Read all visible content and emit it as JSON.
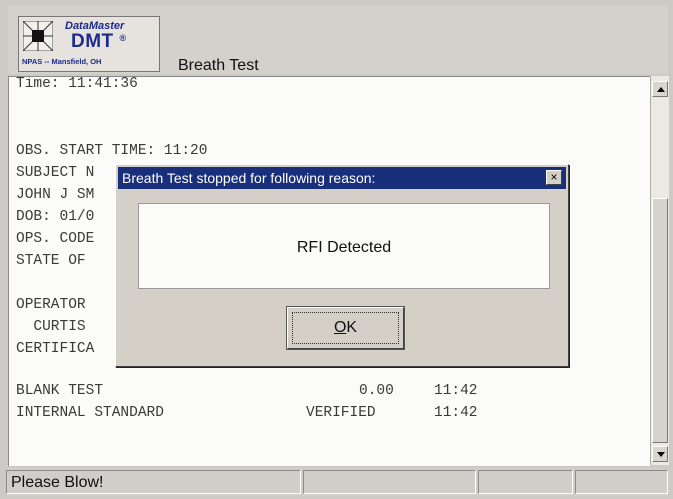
{
  "header": {
    "logo": {
      "brand": "DataMaster",
      "model": "DMT",
      "reg_mark": "®",
      "location": "NPAS -- Mansfield, OH"
    },
    "title": "Breath Test"
  },
  "report": {
    "lines": [
      "Time: 11:41:36",
      "OBS. START TIME: 11:20",
      "SUBJECT N",
      "JOHN J SM",
      "DOB: 01/0",
      "OPS. CODE",
      "STATE OF",
      "OPERATOR",
      "  CURTIS",
      "CERTIFICA"
    ],
    "results": [
      {
        "label": "BLANK TEST",
        "value": "0.00",
        "time": "11:42"
      },
      {
        "label": "INTERNAL STANDARD",
        "value": "VERIFIED",
        "time": "11:42"
      }
    ]
  },
  "dialog": {
    "title": "Breath Test stopped for following reason:",
    "close_glyph": "×",
    "message": "RFI Detected",
    "ok_label_underlined": "O",
    "ok_label_rest": "K"
  },
  "status": {
    "text": "Please Blow!"
  },
  "icons": {
    "scroll_up": "scroll-up-icon",
    "scroll_down": "scroll-down-icon",
    "close": "close-icon"
  },
  "colors": {
    "titlebar": "#1a2f7c",
    "brand_blue": "#1c2b8a"
  }
}
